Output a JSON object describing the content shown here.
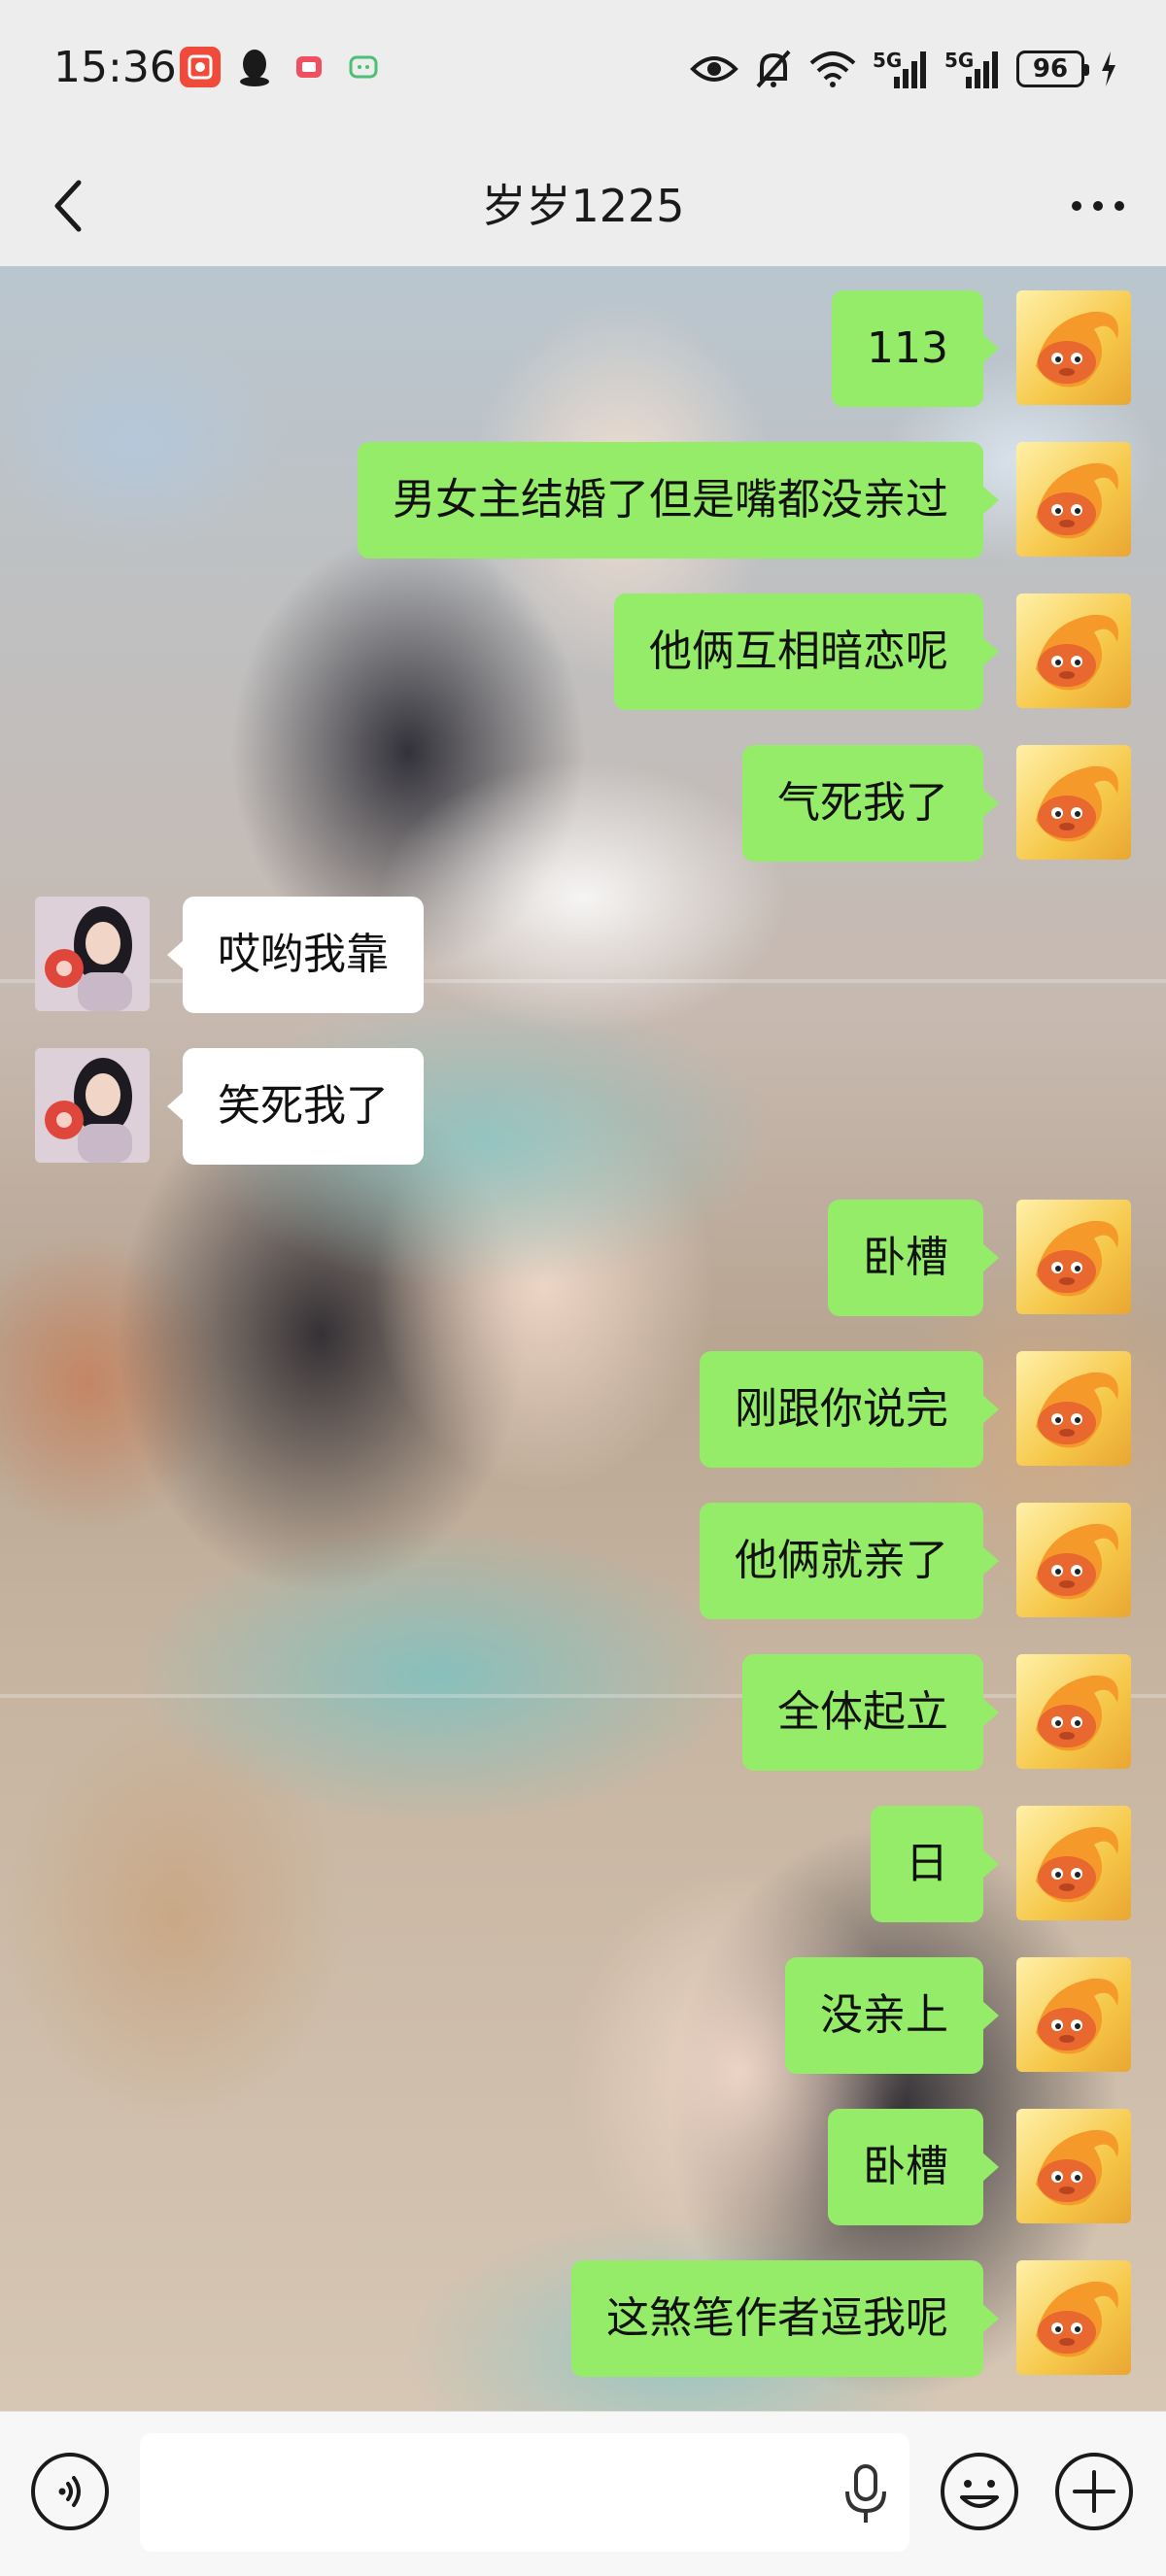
{
  "status_bar": {
    "time": "15:36",
    "battery": "96",
    "network_1": "5G",
    "network_2": "5G",
    "icons": [
      "app-badge-icon",
      "qq-icon",
      "red-app-icon",
      "green-app-icon",
      "eye-icon",
      "mute-bell-icon",
      "wifi-icon",
      "signal-icon",
      "battery-icon",
      "charging-icon"
    ]
  },
  "header": {
    "title": "岁岁1225",
    "back_icon": "chevron-left-icon",
    "more_icon": "more-dots-icon"
  },
  "messages": [
    {
      "from": "me",
      "text": "113"
    },
    {
      "from": "me",
      "text": "男女主结婚了但是嘴都没亲过"
    },
    {
      "from": "me",
      "text": "他俩互相暗恋呢"
    },
    {
      "from": "me",
      "text": "气死我了"
    },
    {
      "from": "other",
      "text": "哎哟我靠"
    },
    {
      "from": "other",
      "text": "笑死我了"
    },
    {
      "from": "me",
      "text": "卧槽"
    },
    {
      "from": "me",
      "text": "刚跟你说完"
    },
    {
      "from": "me",
      "text": "他俩就亲了"
    },
    {
      "from": "me",
      "text": "全体起立"
    },
    {
      "from": "me",
      "text": "日"
    },
    {
      "from": "me",
      "text": "没亲上"
    },
    {
      "from": "me",
      "text": "卧槽"
    },
    {
      "from": "me",
      "text": "这煞笔作者逗我呢"
    }
  ],
  "colors": {
    "my_bubble": "#95ec69",
    "other_bubble": "#ffffff",
    "header_bg": "#ededed"
  },
  "input": {
    "value": "",
    "placeholder": ""
  },
  "toolbar": {
    "icons": [
      "voice-mode-icon",
      "microphone-icon",
      "emoji-icon",
      "plus-icon"
    ]
  }
}
